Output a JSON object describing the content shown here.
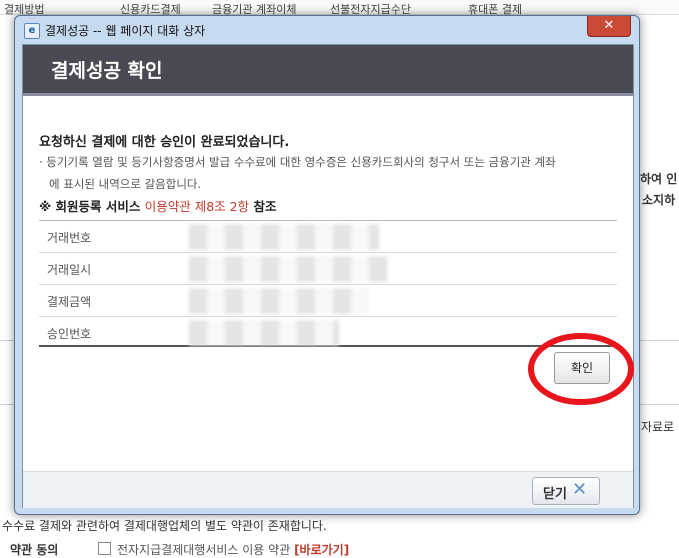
{
  "background": {
    "top_links": [
      "결제방법",
      "신용카드결제",
      "금융기관 계좌이체",
      "선불전자지급수단",
      "휴대폰 결제"
    ],
    "fragments": {
      "right_1": "하여 인",
      "right_2": "소지하",
      "right_3": "자료로",
      "left_bottom_1": "수수료 결제와 관련하여 결제대행업체의 별도 약관이 존재합니다.",
      "left_bottom_2": "약관 동의",
      "left_bottom_3": "전자지급결제대행서비스 이용 약관",
      "left_bottom_link": "[바로가기]"
    }
  },
  "dialog": {
    "window_title": "결제성공 -- 웹 페이지 대화 상자",
    "close_glyph": "✕",
    "header_title": "결제성공 확인",
    "message_main": "요청하신 결제에 대한 승인이 완료되었습니다.",
    "message_bullet": "· 등기기록 열람 및 등기사항증명서 발급 수수료에 대한 영수증은 신용카드회사의 청구서 또는 금융기관 계좌",
    "message_bullet_cont": "에 표시된 내역으로 갈음합니다.",
    "notice_prefix": "※ 회원등록 서비스",
    "notice_link": "이용약관 제8조 2항",
    "notice_suffix": "참조",
    "info_rows": [
      {
        "label": "거래번호",
        "value": ""
      },
      {
        "label": "거래일시",
        "value": ""
      },
      {
        "label": "결제금액",
        "value": ""
      },
      {
        "label": "승인번호",
        "value": ""
      }
    ],
    "confirm_label": "확인",
    "footer_close_label": "닫기",
    "footer_close_icon": "close-x-icon",
    "annotation_color": "#e8161c"
  }
}
